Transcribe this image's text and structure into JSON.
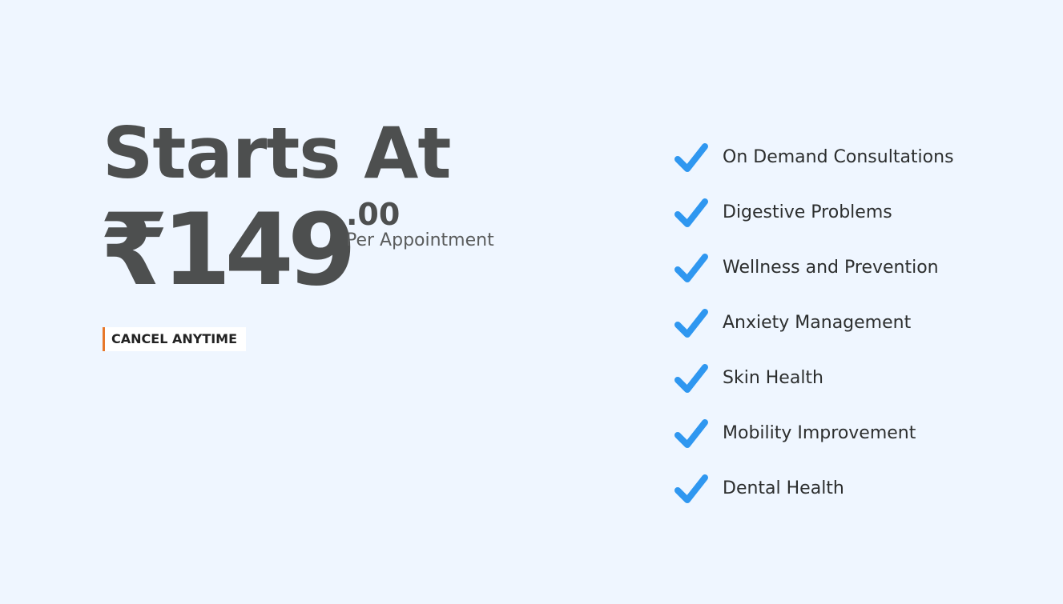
{
  "pricing": {
    "headline": "Starts At",
    "currency_symbol": "₹",
    "amount": "149",
    "cents": ".00",
    "unit": "Per Appointment",
    "badge": "CANCEL ANYTIME",
    "badge_accent_color": "#e8782a"
  },
  "features": {
    "check_color": "#2f97f0",
    "icon": "checkmark-icon",
    "items": [
      {
        "label": "On Demand Consultations"
      },
      {
        "label": "Digestive Problems"
      },
      {
        "label": "Wellness and Prevention"
      },
      {
        "label": "Anxiety Management"
      },
      {
        "label": "Skin Health"
      },
      {
        "label": "Mobility Improvement"
      },
      {
        "label": "Dental Health"
      }
    ]
  }
}
